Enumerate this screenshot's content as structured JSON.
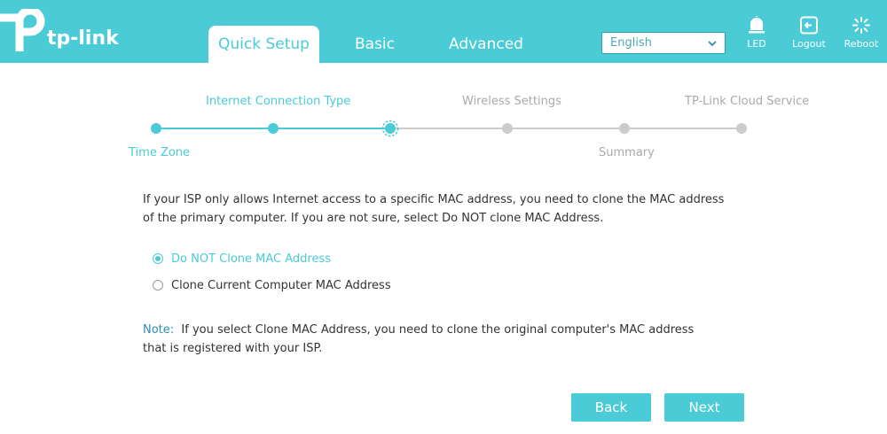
{
  "header": {
    "brand": "tp-link",
    "tabs": [
      {
        "label": "Quick Setup",
        "active": true
      },
      {
        "label": "Basic",
        "active": false
      },
      {
        "label": "Advanced",
        "active": false
      }
    ],
    "language": {
      "selected": "English"
    },
    "actions": [
      {
        "label": "LED",
        "icon": "bulb-icon"
      },
      {
        "label": "Logout",
        "icon": "logout-icon"
      },
      {
        "label": "Reboot",
        "icon": "reboot-icon"
      }
    ]
  },
  "stepper": {
    "steps": [
      {
        "label": "Time Zone",
        "state": "done"
      },
      {
        "label": "Internet Connection Type",
        "state": "done"
      },
      {
        "label": "",
        "state": "current"
      },
      {
        "label": "Wireless Settings",
        "state": "pending"
      },
      {
        "label": "Summary",
        "state": "pending"
      },
      {
        "label": "TP-Link Cloud Service",
        "state": "pending"
      }
    ]
  },
  "content": {
    "description": "If your ISP only allows Internet access to a specific MAC address, you need to clone the MAC address of the primary computer. If you are not sure, select Do NOT clone MAC Address.",
    "options": [
      {
        "label": "Do NOT Clone MAC Address",
        "selected": true
      },
      {
        "label": "Clone Current Computer MAC Address",
        "selected": false
      }
    ],
    "note_label": "Note:",
    "note_text": "If you select Clone MAC Address, you need to clone the original computer's MAC address that is registered with your ISP."
  },
  "buttons": {
    "back": "Back",
    "next": "Next"
  },
  "colors": {
    "accent": "#4acbd6",
    "inactive": "#cccccc",
    "note": "#2a8fb6"
  }
}
